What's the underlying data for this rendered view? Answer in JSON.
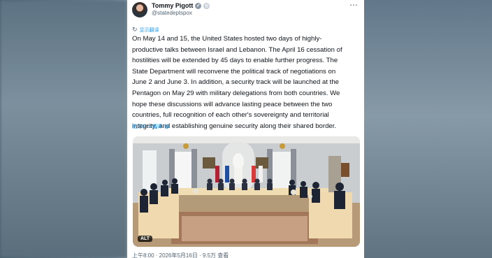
{
  "author": {
    "name": "Tommy Pigott",
    "handle": "@statedeptspox"
  },
  "translate_label": "显示翻译",
  "post_text": "On May 14 and 15, the United States hosted two days of highly-\nproductive talks between Israel and Lebanon. The April 16 cessation of\nhostilities will be extended by 45 days to enable further progress. The\nState Department will reconvene the political track of negotiations on\nJune 2 and June 3. In addition, a security track will be launched at the\nPentagon on May 29 with military delegations from both countries. We\nhope these discussions will advance lasting peace between the two\ncountries, full recognition of each other's sovereignty and territorial\nintegrity, and establishing genuine security along their shared border.",
  "rate_label": "使用Grok翻译",
  "media": {
    "alt_label": "ALT"
  },
  "footer_text": "上午8:00 · 2026年5月16日 · 9.5万 查看",
  "icons": {
    "verified": "verified-badge-icon",
    "more": "more-icon",
    "translate": "translate-icon",
    "grok": "grok-icon"
  }
}
